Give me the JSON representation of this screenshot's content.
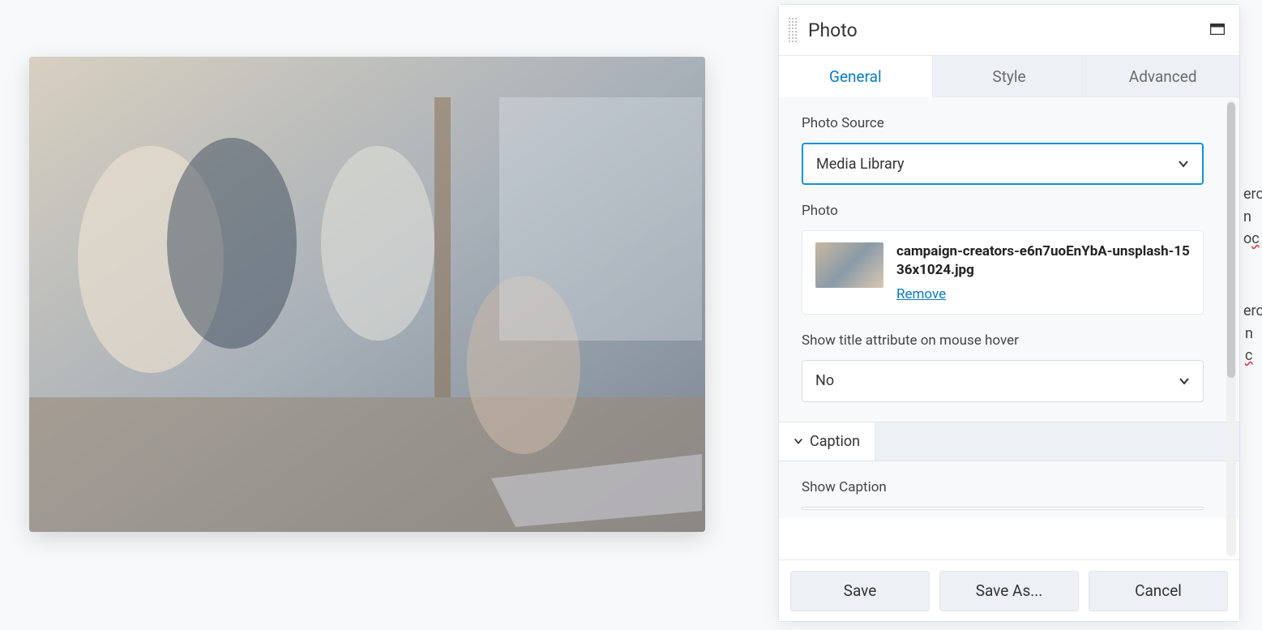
{
  "panel": {
    "title": "Photo",
    "tabs": [
      {
        "label": "General",
        "active": true
      },
      {
        "label": "Style",
        "active": false
      },
      {
        "label": "Advanced",
        "active": false
      }
    ]
  },
  "form": {
    "photo_source": {
      "label": "Photo Source",
      "value": "Media Library"
    },
    "photo": {
      "label": "Photo",
      "filename": "campaign-creators-e6n7uoEnYbA-unsplash-1536x1024.jpg",
      "remove_label": "Remove"
    },
    "title_hover": {
      "label": "Show title attribute on mouse hover",
      "value": "No"
    },
    "caption": {
      "section_label": "Caption",
      "show_label": "Show Caption"
    }
  },
  "footer": {
    "save": "Save",
    "save_as": "Save As...",
    "cancel": "Cancel"
  },
  "bg": {
    "t1": "eros",
    "t2": "n o",
    "t3": "eros",
    "t4": "n "
  }
}
